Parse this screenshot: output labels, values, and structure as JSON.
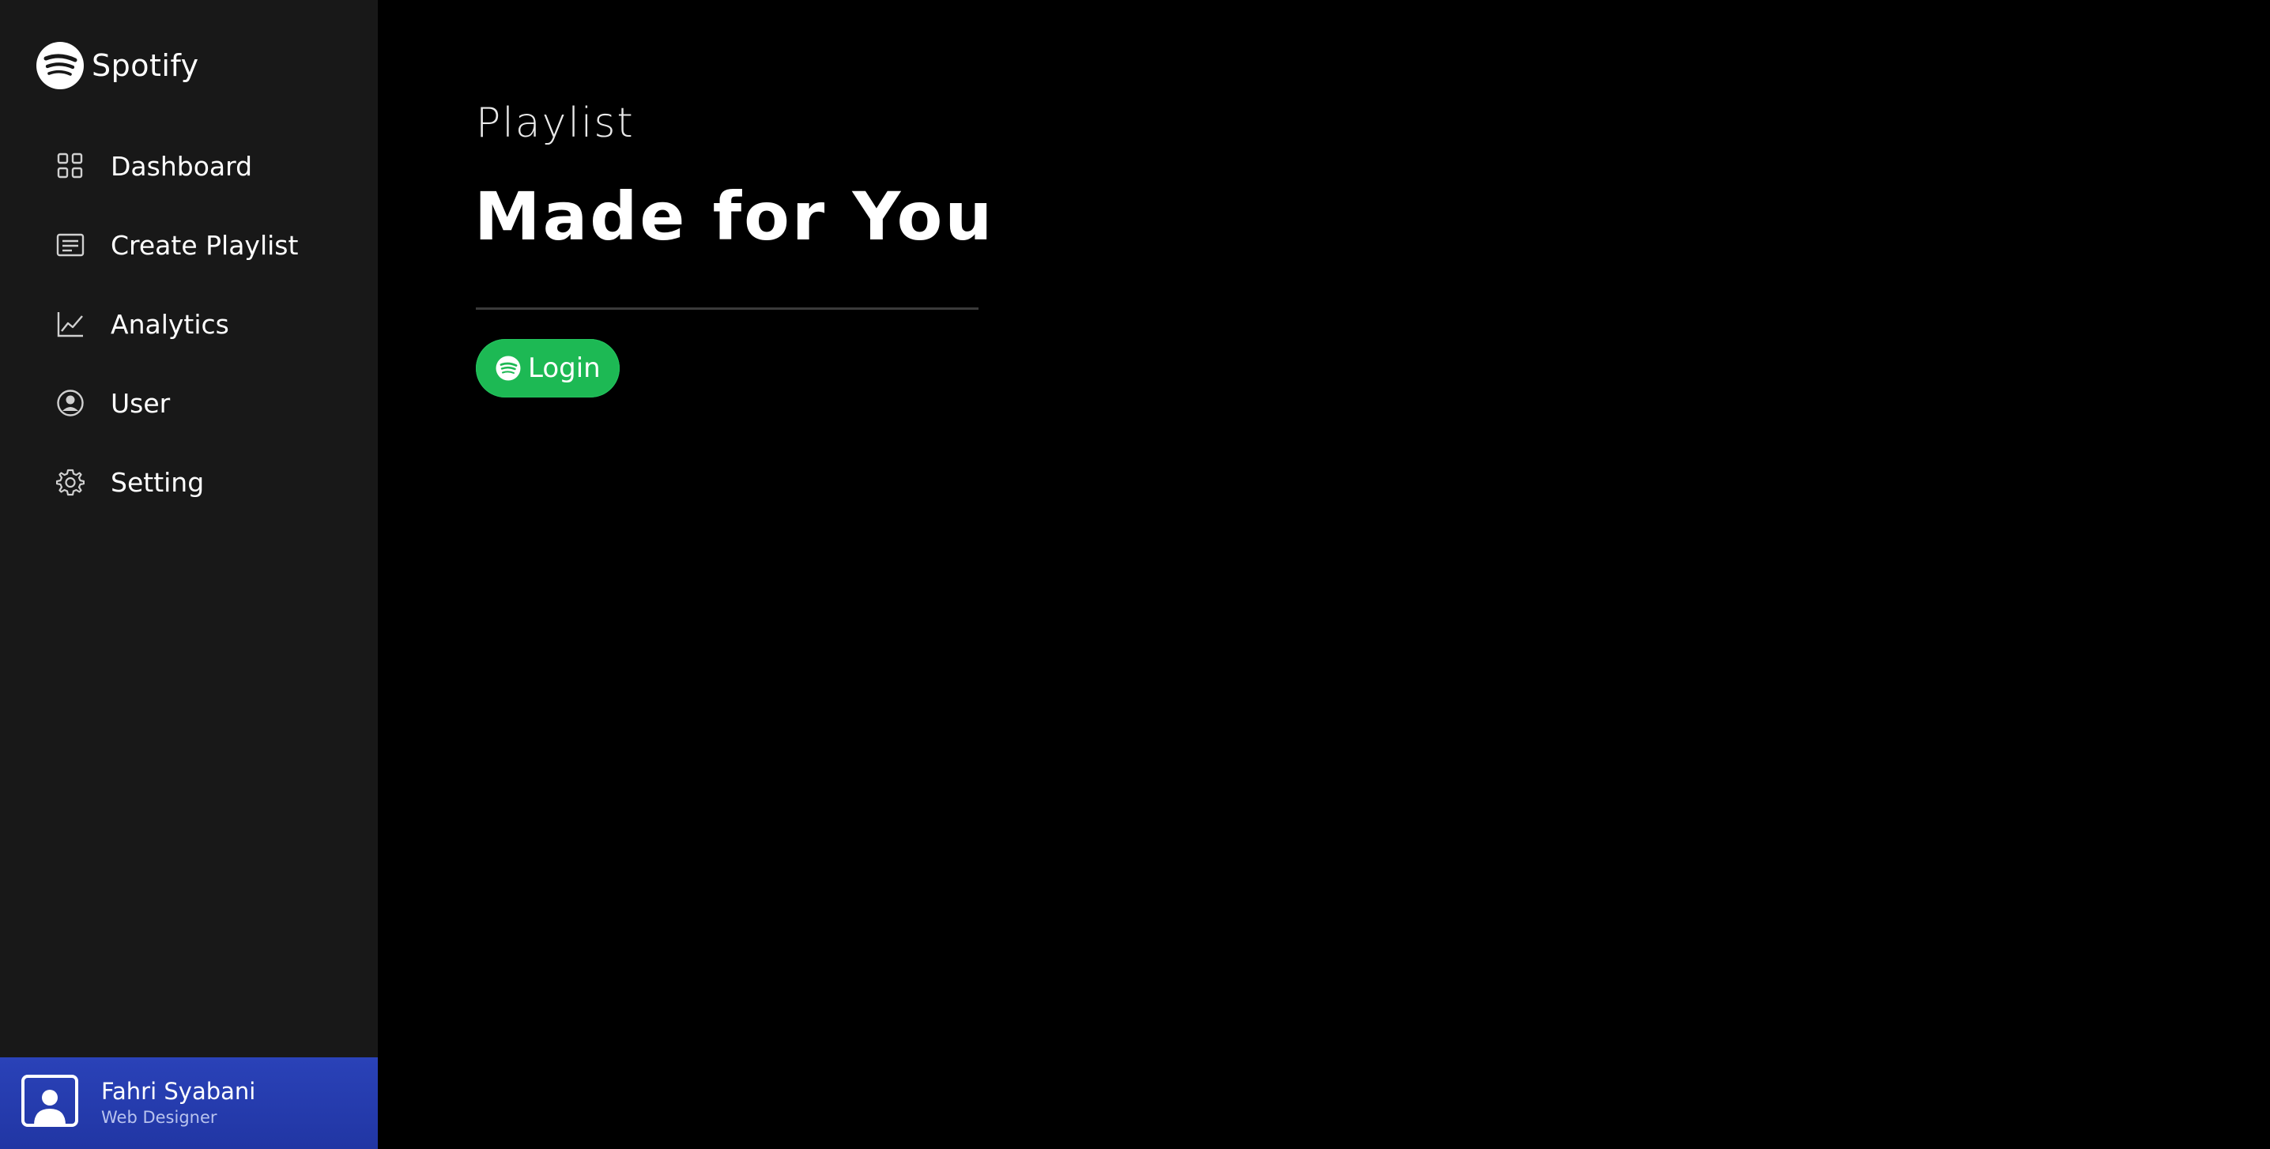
{
  "brand": {
    "name": "Spotify",
    "logo_icon": "spotify-logo-icon"
  },
  "sidebar": {
    "items": [
      {
        "label": "Dashboard",
        "icon": "grid-icon"
      },
      {
        "label": "Create Playlist",
        "icon": "list-icon"
      },
      {
        "label": "Analytics",
        "icon": "line-chart-icon"
      },
      {
        "label": "User",
        "icon": "user-circle-icon"
      },
      {
        "label": "Setting",
        "icon": "gear-icon"
      }
    ]
  },
  "user": {
    "name": "Fahri Syabani",
    "role": "Web Designer",
    "avatar_icon": "user-avatar-icon"
  },
  "main": {
    "eyebrow": "Playlist",
    "title": "Made for You",
    "login_button": {
      "label": "Login",
      "icon": "spotify-logo-icon"
    }
  },
  "colors": {
    "sidebar_bg": "#181818",
    "main_bg": "#000000",
    "accent_green": "#1db954",
    "user_card_blue": "#2a42b8"
  }
}
